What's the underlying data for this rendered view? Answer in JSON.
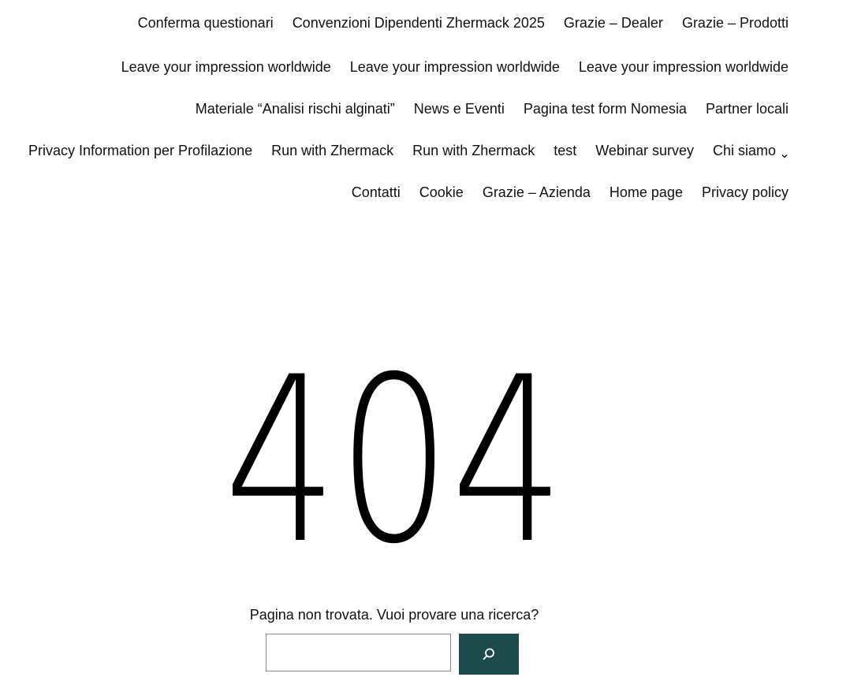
{
  "nav": {
    "rows": [
      [
        "Conferma questionari",
        "Convenzioni Dipendenti Zhermack 2025",
        "Grazie – Dealer",
        "Grazie – Prodotti"
      ],
      [
        "Leave your impression worldwide",
        "Leave your impression worldwide",
        "Leave your impression worldwide"
      ],
      [
        "Materiale “Analisi rischi alginati”",
        "News e Eventi",
        "Pagina test form Nomesia",
        "Partner locali"
      ],
      [
        "Privacy Information per Profilazione",
        "Run with Zhermack",
        "Run with Zhermack",
        "test",
        "Webinar survey",
        "Chi siamo"
      ],
      [
        "Contatti",
        "Cookie",
        "Grazie – Azienda",
        "Home page",
        "Privacy policy"
      ]
    ]
  },
  "error": {
    "code": "404",
    "message": "Pagina non trovata. Vuoi provare una ricerca?"
  },
  "search": {
    "value": "",
    "placeholder": "",
    "button_icon": "search-icon"
  },
  "colors": {
    "text": "#111111",
    "button_bg": "#1d4a4b",
    "button_icon": "#ffffff"
  }
}
